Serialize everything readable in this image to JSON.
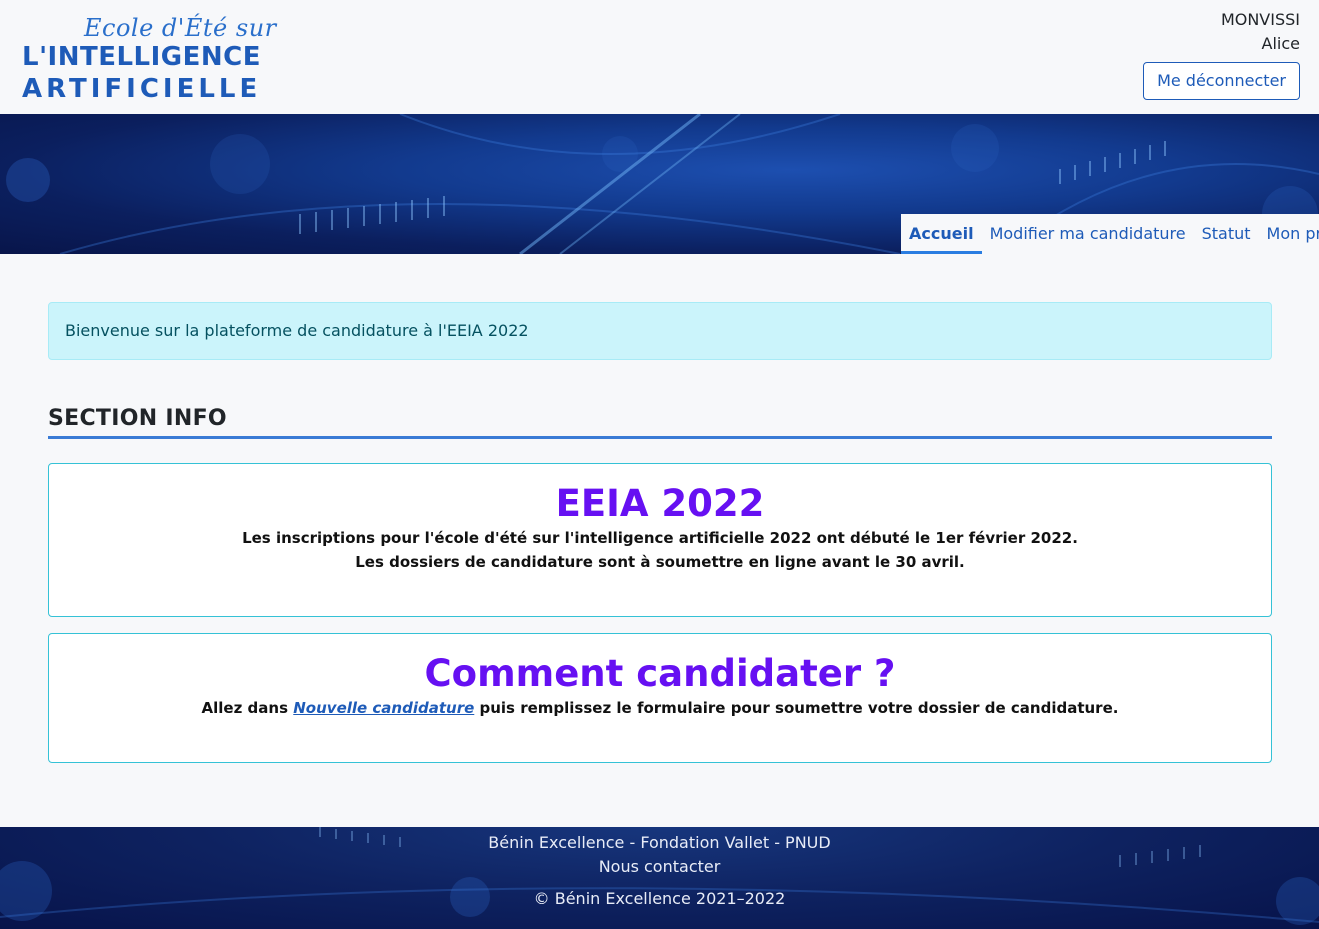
{
  "logo": {
    "script_line": "Ecole d'Été sur",
    "line1": "L'INTELLIGENCE",
    "line2": "ARTIFICIELLE"
  },
  "user": {
    "last_name": "MONVISSI",
    "first_name": "Alice",
    "logout_label": "Me déconnecter"
  },
  "nav": {
    "items": [
      {
        "label": "Accueil",
        "active": true
      },
      {
        "label": "Modifier ma candidature"
      },
      {
        "label": "Statut"
      },
      {
        "label": "Mon profil"
      }
    ]
  },
  "alert": {
    "text": "Bienvenue sur la plateforme de candidature à l'EEIA 2022"
  },
  "section": {
    "title": "SECTION INFO"
  },
  "cards": [
    {
      "title": "EEIA 2022",
      "line1": "Les inscriptions pour l'école d'été sur l'intelligence artificielle 2022 ont débuté le 1er février 2022.",
      "line2": "Les dossiers de candidature sont à soumettre en ligne avant le 30 avril."
    },
    {
      "title": "Comment candidater ?",
      "text_before": "Allez dans ",
      "link": "Nouvelle candidature",
      "text_after": " puis remplissez le formulaire pour soumettre votre dossier de candidature."
    }
  ],
  "footer": {
    "partners": "Bénin Excellence - Fondation Vallet - PNUD",
    "contact": "Nous contacter",
    "copyright": "© Bénin Excellence 2021–2022"
  },
  "colors": {
    "primary": "#1e5bb8",
    "accent_purple": "#6610f2",
    "alert_bg": "#cbf4fb",
    "card_border": "#35c2d6"
  }
}
